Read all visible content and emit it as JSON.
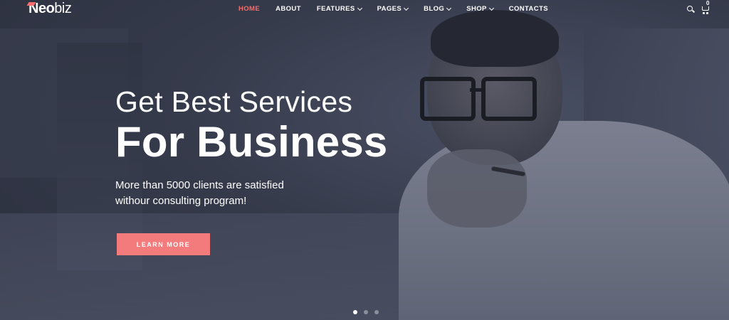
{
  "brand": {
    "logo_bold": "Neo",
    "logo_light": "biz"
  },
  "nav": {
    "items": [
      {
        "label": "HOME",
        "active": true,
        "dropdown": false
      },
      {
        "label": "ABOUT",
        "active": false,
        "dropdown": false
      },
      {
        "label": "FEATURES",
        "active": false,
        "dropdown": true
      },
      {
        "label": "PAGES",
        "active": false,
        "dropdown": true
      },
      {
        "label": "BLOG",
        "active": false,
        "dropdown": true
      },
      {
        "label": "SHOP",
        "active": false,
        "dropdown": true
      },
      {
        "label": "CONTACTS",
        "active": false,
        "dropdown": false
      }
    ],
    "cart_count": "0"
  },
  "hero": {
    "line1": "Get Best Services",
    "line2": "For Business",
    "subtitle_line1": "More than 5000 clients are satisfied",
    "subtitle_line2": "withour consulting program!",
    "cta_label": "LEARN MORE"
  },
  "slider": {
    "total": 3,
    "active_index": 0
  },
  "colors": {
    "accent": "#f46d6d",
    "button": "#f47b7b",
    "overlay": "#363b4c"
  },
  "icons": {
    "search": "search-icon",
    "cart": "cart-icon",
    "chevron": "chevron-down-icon"
  }
}
